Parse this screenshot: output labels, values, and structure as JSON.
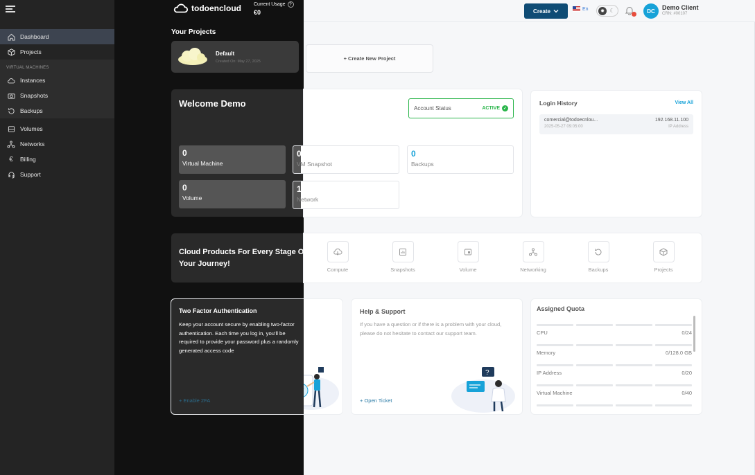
{
  "brand": {
    "name": "todoencloud"
  },
  "usage": {
    "label": "Current Usage",
    "help": "?",
    "value": "€0"
  },
  "topbar": {
    "create_label": "Create",
    "lang": "En"
  },
  "user": {
    "initials": "DC",
    "name": "Demo Client",
    "crn": "CRN: #00107"
  },
  "sidebar": {
    "items": [
      {
        "label": "Dashboard"
      },
      {
        "label": "Projects"
      },
      {
        "label": "Instances"
      },
      {
        "label": "Snapshots"
      },
      {
        "label": "Backups"
      },
      {
        "label": "Volumes"
      },
      {
        "label": "Networks"
      },
      {
        "label": "Billing"
      },
      {
        "label": "Support"
      }
    ],
    "section": "VIRTUAL MACHINES"
  },
  "projects": {
    "title": "Your Projects",
    "default_name": "Default",
    "default_date": "Created On: May 27, 2025",
    "create_label": "+ Create New Project"
  },
  "welcome": {
    "title": "Welcome Demo",
    "account_status_label": "Account Status",
    "account_status_value": "ACTIVE",
    "stats": [
      {
        "value": "0",
        "label": "Virtual Machine"
      },
      {
        "value": "0",
        "label": "VM Snapshot"
      },
      {
        "value": "0",
        "label": "Backups"
      },
      {
        "value": "0",
        "label": "Volume"
      },
      {
        "value": "1",
        "label": "Network"
      }
    ]
  },
  "login_history": {
    "title": "Login History",
    "view_all": "View All",
    "entries": [
      {
        "email": "comercial@todoecnlou...",
        "ip": "192.168.11.100",
        "time": "2025-05-27 09:05:00",
        "ip_label": "IP Address"
      }
    ]
  },
  "products": {
    "title": "Cloud Products For Every Stage Of Your Journey!",
    "items": [
      {
        "label": "Compute",
        "icon": "compute-icon"
      },
      {
        "label": "Snapshots",
        "icon": "snapshot-icon"
      },
      {
        "label": "Volume",
        "icon": "volume-icon"
      },
      {
        "label": "Networking",
        "icon": "network-icon"
      },
      {
        "label": "Backups",
        "icon": "backup-icon"
      },
      {
        "label": "Projects",
        "icon": "project-icon"
      }
    ]
  },
  "tfa": {
    "title": "Two Factor Authentication",
    "text": "Keep your account secure by enabling two-factor authentication. Each time you log in, you'll be required to provide your password plus a randomly generated access code",
    "link": "+ Enable 2FA"
  },
  "help": {
    "title": "Help & Support",
    "text": "If you have a question or if there is a problem with your cloud, please do not hesitate to contact our support team.",
    "link": "+ Open Ticket"
  },
  "quota": {
    "title": "Assigned Quota",
    "rows": [
      {
        "label": "CPU",
        "value": "0/24"
      },
      {
        "label": "Memory",
        "value": "0/128.0 GB"
      },
      {
        "label": "IP Address",
        "value": "0/20"
      },
      {
        "label": "Virtual Machine",
        "value": "0/40"
      }
    ]
  },
  "colors": {
    "accent": "#17a2d8",
    "primary": "#0f4c75",
    "success": "#2ab54a",
    "sidebar": "#242424"
  }
}
